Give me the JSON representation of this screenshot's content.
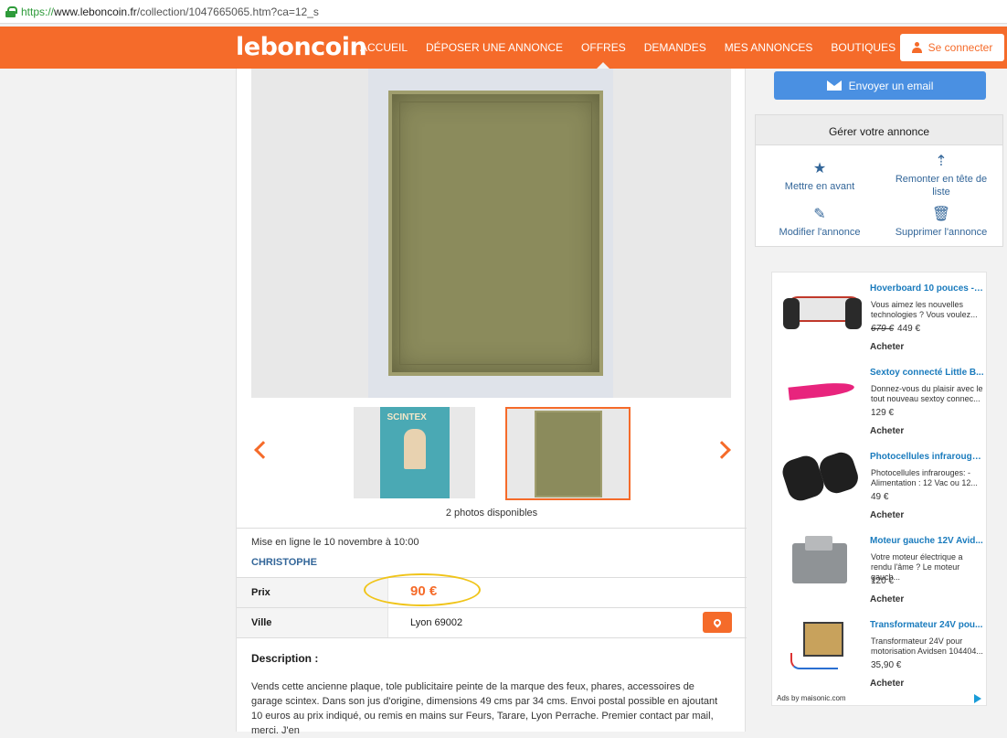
{
  "browser": {
    "scheme": "https://",
    "host": "www.leboncoin.fr",
    "path": "/collection/1047665065.htm?ca=12_s"
  },
  "header": {
    "logo": "leboncoin",
    "nav": [
      "ACCUEIL",
      "DÉPOSER UNE ANNONCE",
      "OFFRES",
      "DEMANDES",
      "MES ANNONCES",
      "BOUTIQUES"
    ],
    "active_nav": "OFFRES",
    "connect_label": "Se connecter"
  },
  "listing": {
    "photos_count": "2 photos disponibles",
    "posted": "Mise en ligne le 10 novembre à 10:00",
    "seller": "CHRISTOPHE",
    "price_label": "Prix",
    "price": "90 €",
    "city_label": "Ville",
    "city": "Lyon 69002",
    "description_title": "Description :",
    "description": "Vends cette ancienne plaque, tole publicitaire peinte de la marque des feux, phares, accessoires de garage scintex. Dans son jus d'origine, dimensions 49 cms par 34 cms. Envoi postal possible en ajoutant 10 euros au prix indiqué, ou remis en mains sur Feurs, Tarare, Lyon Perrache. Premier contact par mail, merci. J'en"
  },
  "sidebar": {
    "email_button": "Envoyer un email",
    "manage_title": "Gérer votre annonce",
    "actions": {
      "feature": "Mettre en avant",
      "bump": "Remonter en tête de liste",
      "edit": "Modifier l'annonce",
      "delete": "Supprimer l'annonce"
    }
  },
  "ads": {
    "items": [
      {
        "title": "Hoverboard 10 pouces - ...",
        "desc": "Vous aimez les nouvelles technologies ? Vous voulez...",
        "old_price": "679 €",
        "price": "449 €",
        "buy": "Acheter"
      },
      {
        "title": "Sextoy connecté Little B...",
        "desc": "Donnez-vous du plaisir avec le tout nouveau sextoy connec...",
        "price": "129 €",
        "buy": "Acheter"
      },
      {
        "title": "Photocellules infrarouge...",
        "desc": "Photocellules infrarouges: - Alimentation : 12 Vac ou 12...",
        "price": "49 €",
        "buy": "Acheter"
      },
      {
        "title": "Moteur gauche 12V Avid...",
        "desc": "Votre moteur électrique a rendu l'âme ? Le moteur gauch...",
        "price": "120 €",
        "buy": "Acheter"
      },
      {
        "title": "Transformateur 24V pou...",
        "desc": "Transformateur 24V pour motorisation Avidsen 104404...",
        "price": "35,90 €",
        "buy": "Acheter"
      }
    ],
    "footer": "Ads by maisonic.com"
  },
  "colors": {
    "brand": "#f56b2a",
    "email": "#4a90e2",
    "link": "#336699",
    "highlight": "#f0c419"
  }
}
